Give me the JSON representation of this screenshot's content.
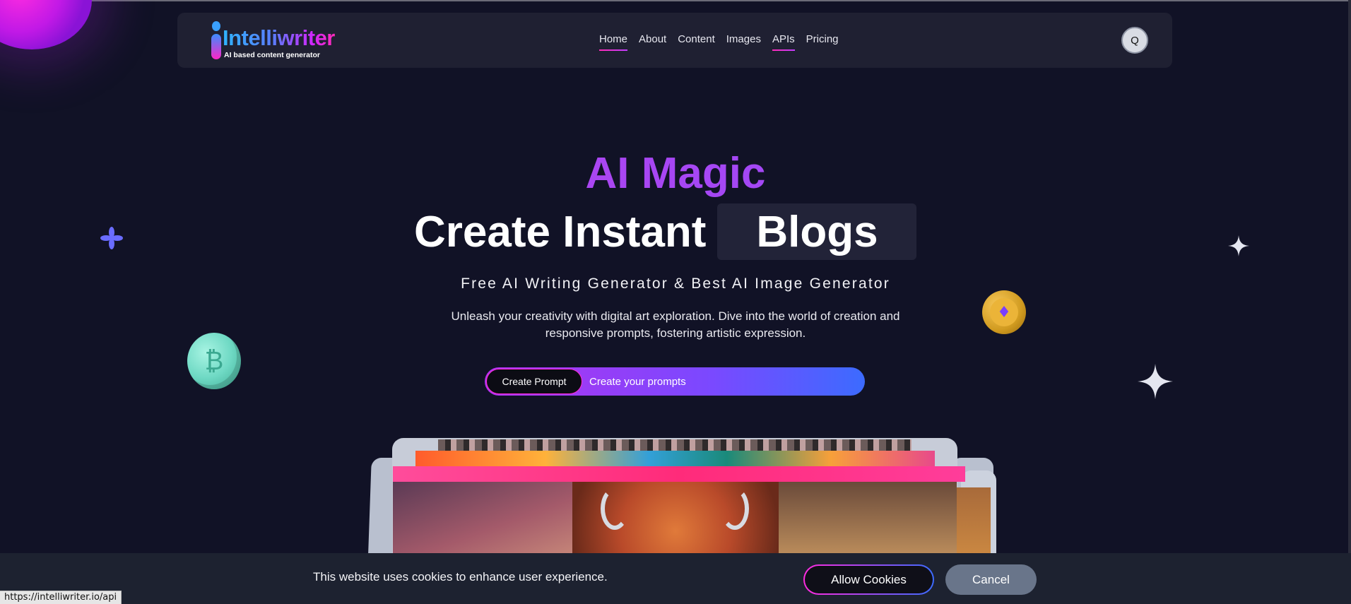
{
  "brand": {
    "name": "Intelliwriter",
    "tagline": "AI based content generator"
  },
  "nav": {
    "items": [
      {
        "label": "Home",
        "underlined": true
      },
      {
        "label": "About",
        "underlined": false
      },
      {
        "label": "Content",
        "underlined": false
      },
      {
        "label": "Images",
        "underlined": false
      },
      {
        "label": "APIs",
        "underlined": true
      },
      {
        "label": "Pricing",
        "underlined": false
      }
    ],
    "search_label": "Q"
  },
  "hero": {
    "kicker": "AI Magic",
    "title": "Create Instant",
    "rotating_word": "Blogs",
    "subtitle": "Free AI Writing Generator & Best AI Image Generator",
    "description": "Unleash your creativity with digital art exploration. Dive into the world of creation and responsive prompts, fostering artistic expression."
  },
  "prompt": {
    "button_label": "Create Prompt",
    "placeholder": "Create your prompts"
  },
  "decor": {
    "btc_symbol": "₿",
    "eth_symbol": "♦"
  },
  "cookie": {
    "message": "This website uses cookies to enhance user experience.",
    "allow_label": "Allow Cookies",
    "cancel_label": "Cancel"
  },
  "status_bar": {
    "url": "https://intelliwriter.io/api"
  },
  "colors": {
    "background": "#111226",
    "navbar": "#1f2032",
    "accent_pink": "#ff2bd8",
    "accent_purple": "#8e4dff",
    "accent_blue": "#3c6bff",
    "cookie_bar": "#1d2230",
    "cancel_button": "#69758a"
  }
}
